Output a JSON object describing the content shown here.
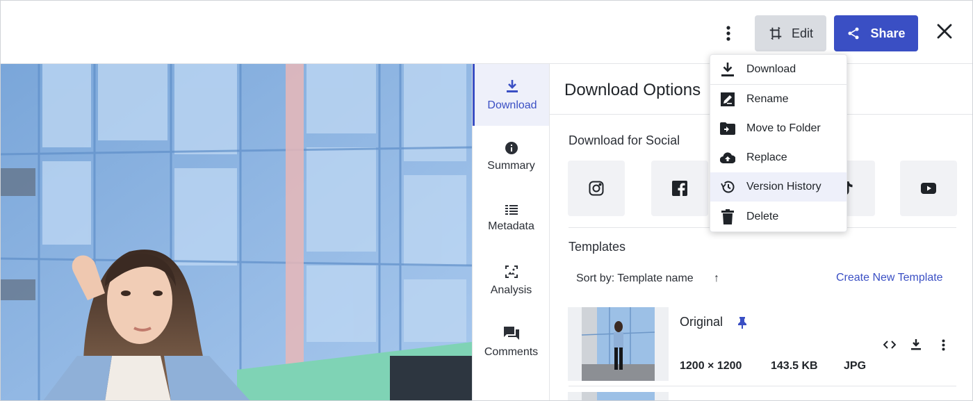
{
  "header": {
    "edit_label": "Edit",
    "share_label": "Share"
  },
  "sidenav": {
    "items": [
      {
        "label": "Download",
        "icon": "download-icon",
        "active": true
      },
      {
        "label": "Summary",
        "icon": "info-icon",
        "active": false
      },
      {
        "label": "Metadata",
        "icon": "list-icon",
        "active": false
      },
      {
        "label": "Analysis",
        "icon": "image-analysis-icon",
        "active": false
      },
      {
        "label": "Comments",
        "icon": "comments-icon",
        "active": false
      }
    ]
  },
  "panel": {
    "title": "Download Options",
    "social_title": "Download for Social",
    "social_icons": [
      "instagram-icon",
      "facebook-icon",
      "tiktok-icon",
      "youtube-icon"
    ],
    "templates_title": "Templates",
    "sort_label": "Sort by: Template name",
    "sort_arrow": "↑",
    "create_link": "Create New Template",
    "template": {
      "name": "Original",
      "dimensions": "1200 × 1200",
      "size": "143.5 KB",
      "format": "JPG"
    }
  },
  "menu": {
    "items": [
      {
        "label": "Download",
        "icon": "download-icon"
      },
      {
        "label": "Rename",
        "icon": "rename-icon"
      },
      {
        "label": "Move to Folder",
        "icon": "move-folder-icon"
      },
      {
        "label": "Replace",
        "icon": "cloud-upload-icon"
      },
      {
        "label": "Version History",
        "icon": "history-icon",
        "highlighted": true
      },
      {
        "label": "Delete",
        "icon": "trash-icon"
      }
    ]
  },
  "colors": {
    "accent": "#3a4fc4",
    "edit_bg": "#d9dce1",
    "tile_bg": "#f1f2f5",
    "highlight_bg": "#eef0fa"
  }
}
